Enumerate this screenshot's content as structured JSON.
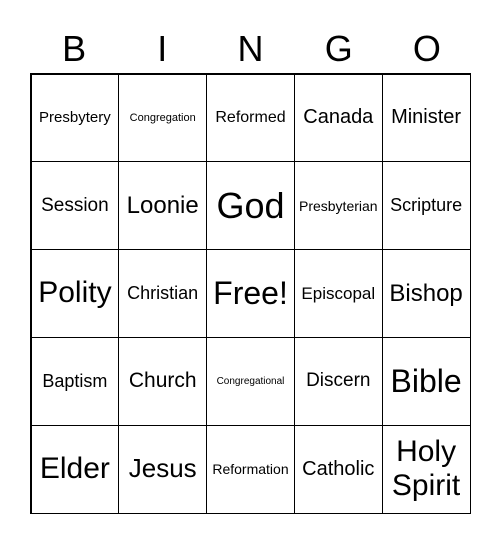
{
  "header": [
    "B",
    "I",
    "N",
    "G",
    "O"
  ],
  "cells": [
    [
      "Presbytery",
      "Congregation",
      "Reformed",
      "Canada",
      "Minister"
    ],
    [
      "Session",
      "Loonie",
      "God",
      "Presbyterian",
      "Scripture"
    ],
    [
      "Polity",
      "Christian",
      "Free!",
      "Episcopal",
      "Bishop"
    ],
    [
      "Baptism",
      "Church",
      "Congregational",
      "Discern",
      "Bible"
    ],
    [
      "Elder",
      "Jesus",
      "Reformation",
      "Catholic",
      "Holy Spirit"
    ]
  ]
}
